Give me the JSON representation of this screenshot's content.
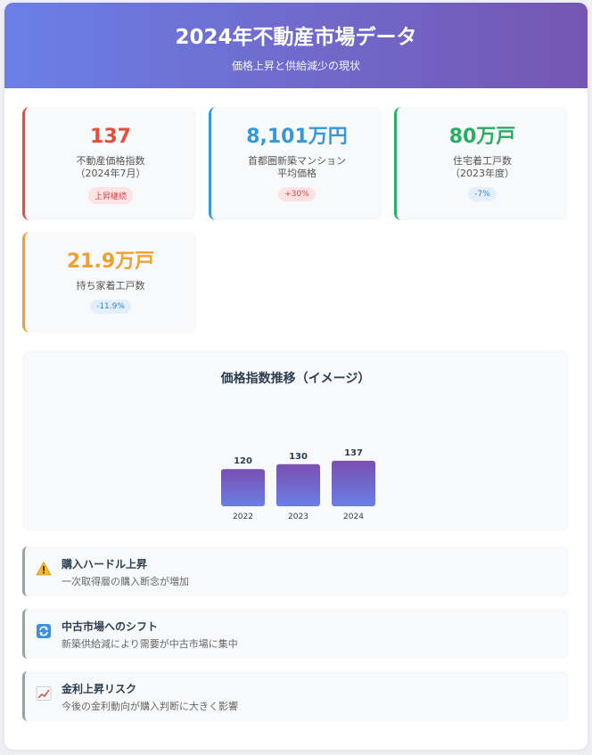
{
  "header": {
    "title": "2024年不動産市場データ",
    "subtitle": "価格上昇と供給減少の現状"
  },
  "stats": [
    {
      "value": "137",
      "label": "不動産価格指数\n（2024年7月）",
      "badge": "上昇継続",
      "color": "#e74c3c",
      "badge_style": "red"
    },
    {
      "value": "8,101万円",
      "label": "首都圏新築マンション\n平均価格",
      "badge": "+30%",
      "color": "#3498db",
      "badge_style": "red"
    },
    {
      "value": "80万戸",
      "label": "住宅着工戸数\n（2023年度）",
      "badge": "-7%",
      "color": "#27ae60",
      "badge_style": "blue"
    },
    {
      "value": "21.9万戸",
      "label": "持ち家着工戸数",
      "badge": "-11.9%",
      "color": "#f0a030",
      "badge_style": "blue"
    }
  ],
  "chart_data": {
    "type": "bar",
    "title": "価格指数推移（イメージ）",
    "categories": [
      "2022",
      "2023",
      "2024"
    ],
    "values": [
      120,
      130,
      137
    ],
    "bar_color_top": "#7a4fb0",
    "bar_color_bottom": "#6a7fe6"
  },
  "points": [
    {
      "icon": "warning-icon",
      "title": "購入ハードル上昇",
      "desc": "一次取得層の購入断念が増加"
    },
    {
      "icon": "refresh-icon",
      "title": "中古市場へのシフト",
      "desc": "新築供給減により需要が中古市場に集中"
    },
    {
      "icon": "chart-up-icon",
      "title": "金利上昇リスク",
      "desc": "今後の金利動向が購入判断に大きく影響"
    }
  ]
}
